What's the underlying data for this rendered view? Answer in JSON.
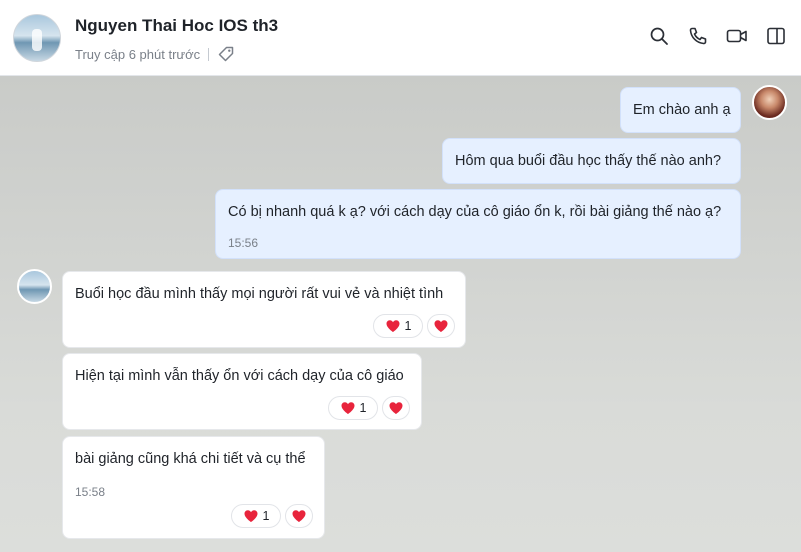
{
  "header": {
    "contact_name": "Nguyen Thai Hoc IOS th3",
    "status": "Truy cập 6 phút trước",
    "icons": [
      "search-icon",
      "phone-icon",
      "video-icon",
      "sidebar-icon"
    ]
  },
  "messages": [
    {
      "direction": "out",
      "text": "Em chào anh ạ"
    },
    {
      "direction": "out",
      "text": "Hôm qua buổi đầu học thấy thế nào anh?"
    },
    {
      "direction": "out",
      "text": "Có bị nhanh quá k ạ? với cách dạy của cô giáo ổn k, rồi bài giảng thế nào ạ?",
      "time": "15:56"
    },
    {
      "direction": "in",
      "text": "Buổi học đầu mình thấy mọi người rất vui vẻ và nhiệt tình",
      "reaction_count": "1"
    },
    {
      "direction": "in",
      "text": "Hiện tại mình vẫn thấy ổn với cách dạy của cô giáo",
      "reaction_count": "1"
    },
    {
      "direction": "in",
      "text": "bài giảng cũng khá chi tiết và cụ thể",
      "time": "15:58",
      "reaction_count": "1"
    }
  ],
  "colors": {
    "outgoing_bubble": "#e6f0ff",
    "incoming_bubble": "#ffffff",
    "heart": "#e8243c"
  }
}
